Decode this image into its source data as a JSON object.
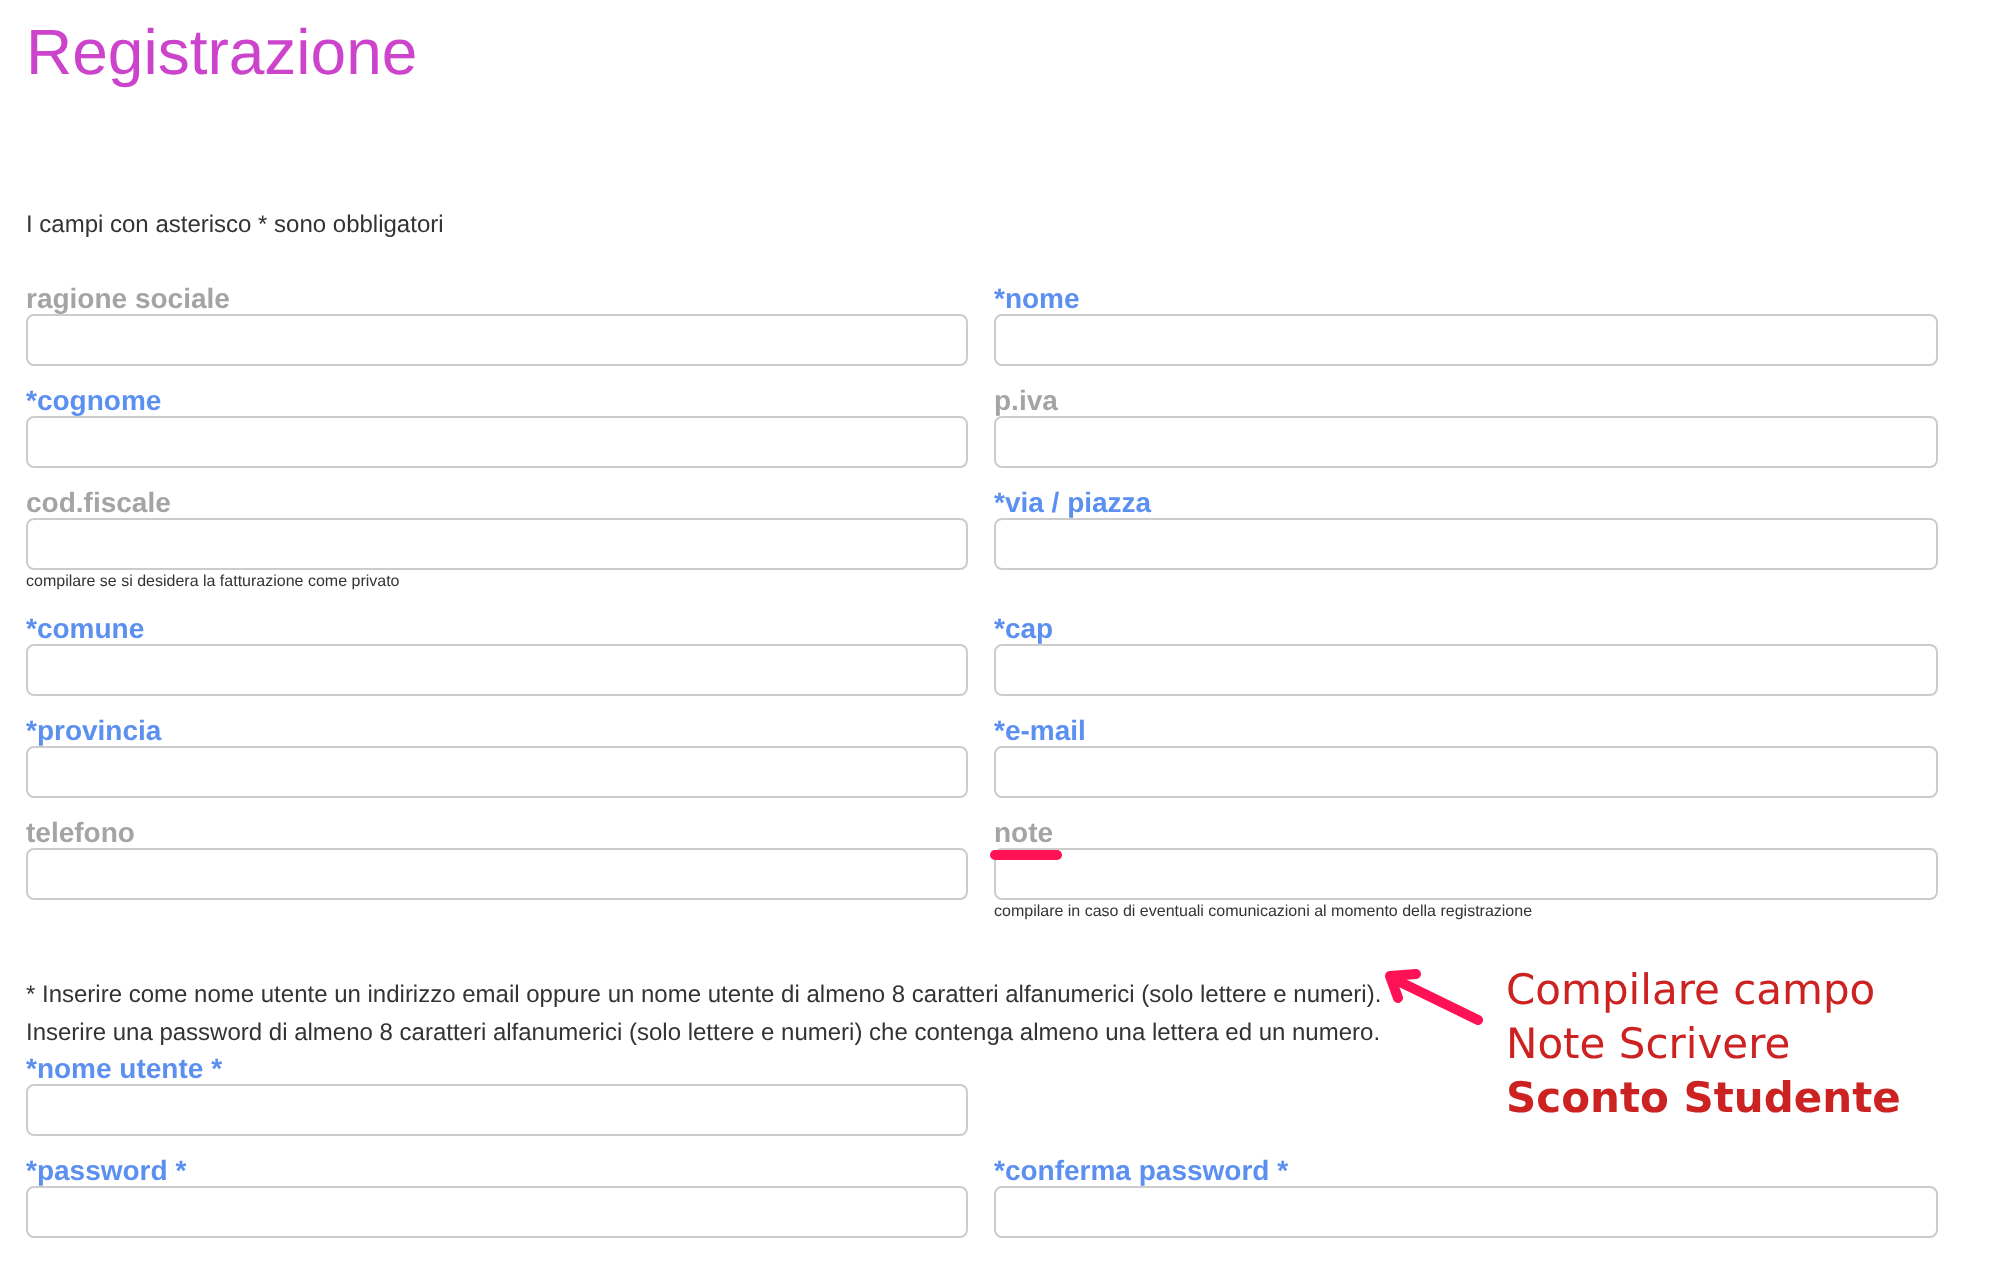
{
  "title": "Registrazione",
  "intro": "I campi con asterisco * sono obbligatori",
  "rows": [
    [
      {
        "label": "ragione sociale",
        "required": false
      },
      {
        "label": "*nome",
        "required": true
      }
    ],
    [
      {
        "label": "*cognome",
        "required": true
      },
      {
        "label": "p.iva",
        "required": false
      }
    ],
    [
      {
        "label": "cod.fiscale",
        "required": false,
        "hint": "compilare se si desidera la fatturazione come privato"
      },
      {
        "label": "*via / piazza",
        "required": true
      }
    ],
    [
      {
        "label": "*comune",
        "required": true
      },
      {
        "label": "*cap",
        "required": true
      }
    ],
    [
      {
        "label": "*provincia",
        "required": true
      },
      {
        "label": "*e-mail",
        "required": true
      }
    ],
    [
      {
        "label": "telefono",
        "required": false
      },
      {
        "label": "note",
        "required": false,
        "hint": "compilare in caso di eventuali comunicazioni al momento della registrazione"
      }
    ]
  ],
  "notice": [
    "* Inserire come nome utente un indirizzo email oppure un nome utente di almeno 8 caratteri alfanumerici (solo lettere e numeri).",
    "Inserire una password di almeno 8 caratteri alfanumerici (solo lettere e numeri) che contenga almeno una lettera ed un numero."
  ],
  "account_rows": [
    [
      {
        "label": "*nome utente *",
        "required": true
      }
    ],
    [
      {
        "label": "*password *",
        "required": true
      },
      {
        "label": "*conferma password *",
        "required": true
      }
    ]
  ],
  "annotation": {
    "lines": [
      {
        "text": "Compilare campo",
        "bold": false
      },
      {
        "text": "Note Scrivere",
        "bold": false
      },
      {
        "text": "Sconto Studente",
        "bold": true
      }
    ]
  }
}
